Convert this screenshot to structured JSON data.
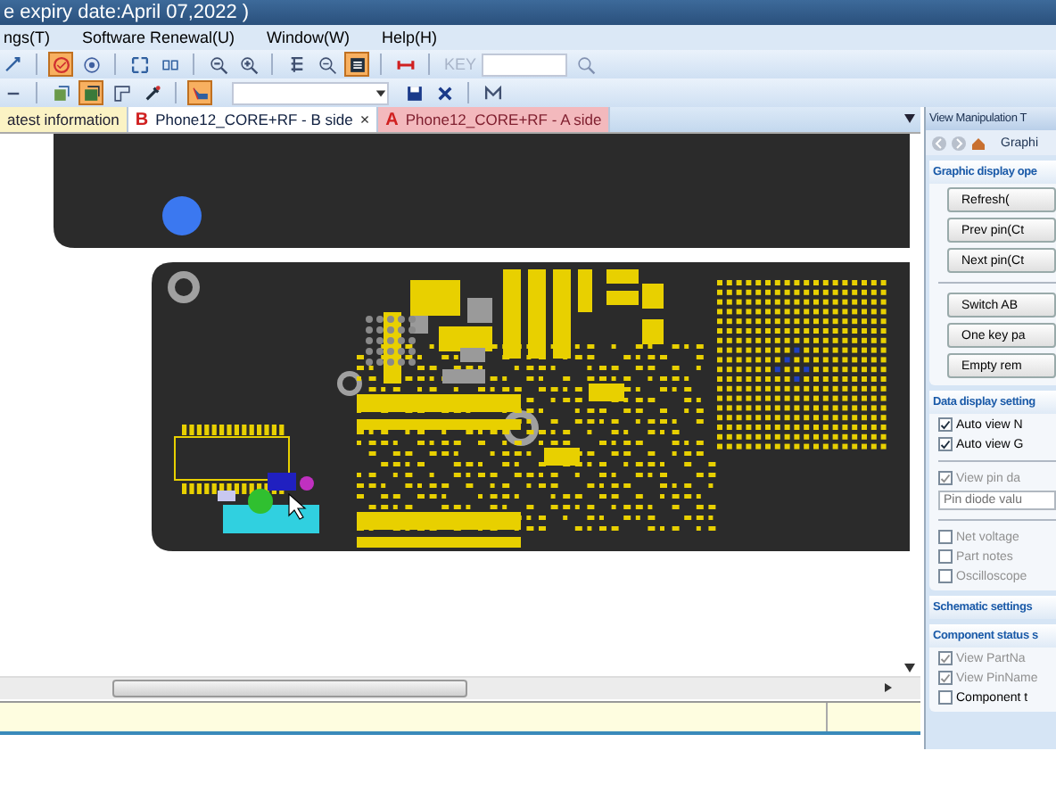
{
  "window": {
    "title": "e expiry date:April 07,2022 )"
  },
  "menu": [
    "ngs(T)",
    "Software Renewal(U)",
    "Window(W)",
    "Help(H)"
  ],
  "toolbars": [
    [
      {
        "kind": "icon",
        "selected": false
      },
      {
        "kind": "separator"
      },
      {
        "kind": "icon",
        "selected": true
      },
      {
        "kind": "icon",
        "selected": false
      },
      {
        "kind": "separator"
      },
      {
        "kind": "icon",
        "selected": false
      },
      {
        "kind": "icon",
        "selected": false
      },
      {
        "kind": "separator"
      },
      {
        "kind": "icon",
        "selected": false
      },
      {
        "kind": "icon",
        "selected": false
      },
      {
        "kind": "separator"
      },
      {
        "kind": "icon",
        "selected": false
      },
      {
        "kind": "icon",
        "selected": false
      },
      {
        "kind": "icon",
        "selected": true
      },
      {
        "kind": "separator"
      },
      {
        "kind": "icon",
        "selected": false
      },
      {
        "kind": "separator"
      },
      {
        "kind": "label",
        "text": "KEY",
        "disabled": true
      },
      {
        "kind": "field"
      },
      {
        "kind": "icon",
        "selected": false
      }
    ],
    [
      {
        "kind": "icon",
        "selected": false
      },
      {
        "kind": "separator"
      },
      {
        "kind": "icon",
        "selected": false
      },
      {
        "kind": "icon",
        "selected": true
      },
      {
        "kind": "icon",
        "selected": false
      },
      {
        "kind": "icon",
        "selected": false
      },
      {
        "kind": "separator"
      },
      {
        "kind": "icon",
        "selected": true
      },
      {
        "kind": "combo"
      },
      {
        "kind": "icon",
        "selected": false
      },
      {
        "kind": "icon",
        "selected": false
      },
      {
        "kind": "separator"
      },
      {
        "kind": "icon",
        "selected": false
      }
    ]
  ],
  "tabs": [
    {
      "kind": "info",
      "label": "atest information",
      "selected": false
    },
    {
      "kind": "board",
      "letter": "B",
      "label": "Phone12_CORE+RF - B side",
      "selected": true,
      "close": "×"
    },
    {
      "kind": "board",
      "letter": "A",
      "label": "Phone12_CORE+RF - A side",
      "selected": false
    }
  ],
  "side_panel": {
    "title": "View Manipulation T",
    "tab": "Graphi",
    "sections": [
      {
        "title": "Graphic display ope",
        "items": [
          {
            "kind": "button",
            "label": "Refresh("
          },
          {
            "kind": "button",
            "label": "Prev pin(Ct"
          },
          {
            "kind": "button",
            "label": "Next pin(Ct"
          },
          {
            "kind": "divider"
          },
          {
            "kind": "button",
            "label": "Switch AB"
          },
          {
            "kind": "button",
            "label": "One key pa"
          },
          {
            "kind": "button",
            "label": "Empty rem"
          }
        ]
      },
      {
        "title": "Data display setting",
        "items": [
          {
            "kind": "checkbox",
            "label": "Auto view N",
            "checked": true,
            "disabled": false
          },
          {
            "kind": "checkbox",
            "label": "Auto view G",
            "checked": true,
            "disabled": false
          },
          {
            "kind": "divider"
          },
          {
            "kind": "checkbox",
            "label": "View pin da",
            "checked": true,
            "disabled": true
          },
          {
            "kind": "field",
            "value": "Pin diode valu"
          },
          {
            "kind": "divider"
          },
          {
            "kind": "checkbox",
            "label": "Net voltage",
            "checked": false,
            "disabled": true
          },
          {
            "kind": "checkbox",
            "label": "Part notes",
            "checked": false,
            "disabled": true
          },
          {
            "kind": "checkbox",
            "label": "Oscilloscope",
            "checked": false,
            "disabled": true
          }
        ]
      },
      {
        "title": "Schematic settings"
      },
      {
        "title": "Component status s",
        "items": [
          {
            "kind": "checkbox",
            "label": "View PartNa",
            "checked": true,
            "disabled": true
          },
          {
            "kind": "checkbox",
            "label": "View PinName",
            "checked": true,
            "disabled": true
          },
          {
            "kind": "checkbox",
            "label": "Component t",
            "checked": false,
            "disabled": false
          }
        ]
      }
    ]
  }
}
